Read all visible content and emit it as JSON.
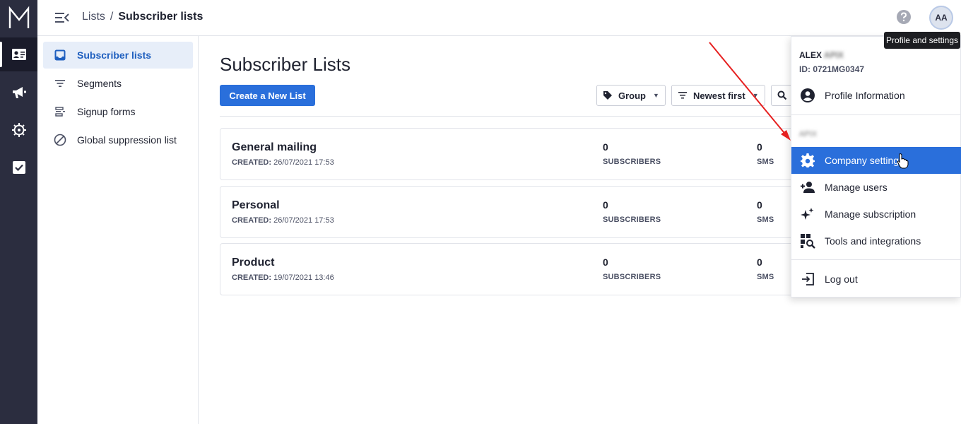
{
  "rail": {
    "logo_letter": "M",
    "items": [
      {
        "icon": "contacts-icon",
        "active": true
      },
      {
        "icon": "megaphone-icon",
        "active": false
      },
      {
        "icon": "automation-icon",
        "active": false
      },
      {
        "icon": "checkbox-icon",
        "active": false
      }
    ]
  },
  "header": {
    "breadcrumb_parent": "Lists",
    "breadcrumb_sep": "/",
    "breadcrumb_current": "Subscriber lists",
    "avatar_initials": "AA",
    "tooltip": "Profile and settings"
  },
  "subnav": {
    "items": [
      {
        "label": "Subscriber lists",
        "icon": "inbox-icon",
        "active": true
      },
      {
        "label": "Segments",
        "icon": "filter-icon",
        "active": false
      },
      {
        "label": "Signup forms",
        "icon": "form-icon",
        "active": false
      },
      {
        "label": "Global suppression list",
        "icon": "block-icon",
        "active": false
      }
    ]
  },
  "main": {
    "title": "Subscriber Lists",
    "create_button": "Create a New List",
    "group_filter": "Group",
    "sort_filter": "Newest first",
    "created_prefix": "CREATED:",
    "lists": [
      {
        "name": "General mailing",
        "created": "26/07/2021 17:53",
        "subscribers": "0",
        "subscribers_label": "SUBSCRIBERS",
        "sms": "0",
        "sms_label": "SMS"
      },
      {
        "name": "Personal",
        "created": "26/07/2021 17:53",
        "subscribers": "0",
        "subscribers_label": "SUBSCRIBERS",
        "sms": "0",
        "sms_label": "SMS"
      },
      {
        "name": "Product",
        "created": "19/07/2021 13:46",
        "subscribers": "0",
        "subscribers_label": "SUBSCRIBERS",
        "sms": "0",
        "sms_label": "SMS"
      }
    ]
  },
  "dropdown": {
    "user_name": "ALEX",
    "user_surname_blurred": "APIX",
    "user_id": "ID: 0721MG0347",
    "company_blurred": "APIX",
    "profile_info": "Profile Information",
    "company_settings": "Company settings",
    "manage_users": "Manage users",
    "manage_subscription": "Manage subscription",
    "tools_integrations": "Tools and integrations",
    "log_out": "Log out"
  },
  "colors": {
    "rail_bg": "#2b2d3f",
    "accent": "#2a6fdb",
    "annotation_arrow": "#e62020"
  }
}
